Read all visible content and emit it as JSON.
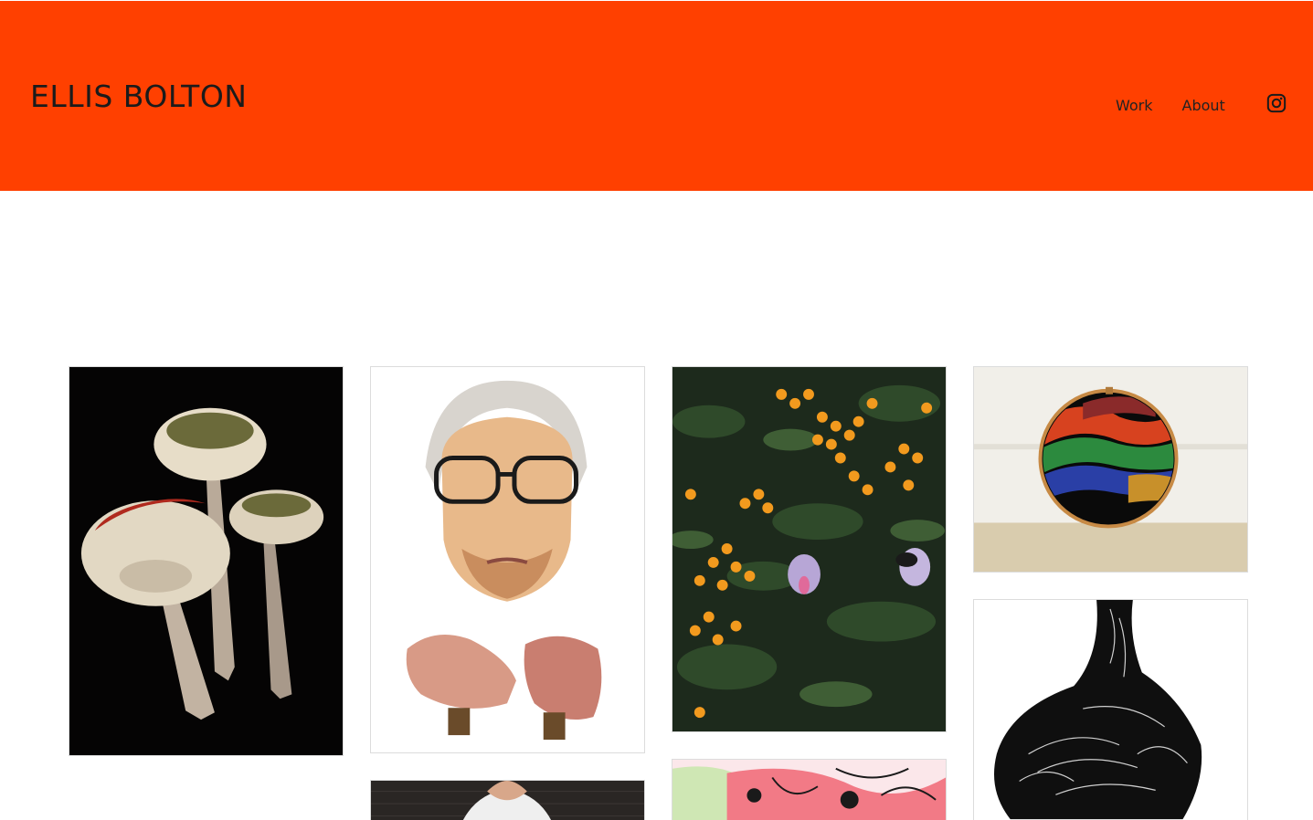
{
  "site": {
    "title": "ELLIS BOLTON"
  },
  "nav": {
    "items": [
      {
        "label": "Work"
      },
      {
        "label": "About"
      }
    ],
    "social_icon": "instagram-icon"
  },
  "colors": {
    "header_bg": "#ff4000",
    "page_bg": "#ffffff",
    "text": "#1b1b1b"
  },
  "gallery": {
    "items": [
      {
        "subject": "mushrooms",
        "icon": "image"
      },
      {
        "subject": "portrait-elderly-woman",
        "icon": "image"
      },
      {
        "subject": "berries-faces",
        "icon": "image"
      },
      {
        "subject": "embroidery-hoop",
        "icon": "image"
      },
      {
        "subject": "ink-drawing",
        "icon": "image"
      },
      {
        "subject": "person-tshirt",
        "icon": "image"
      },
      {
        "subject": "abstract-colour",
        "icon": "image"
      }
    ]
  }
}
